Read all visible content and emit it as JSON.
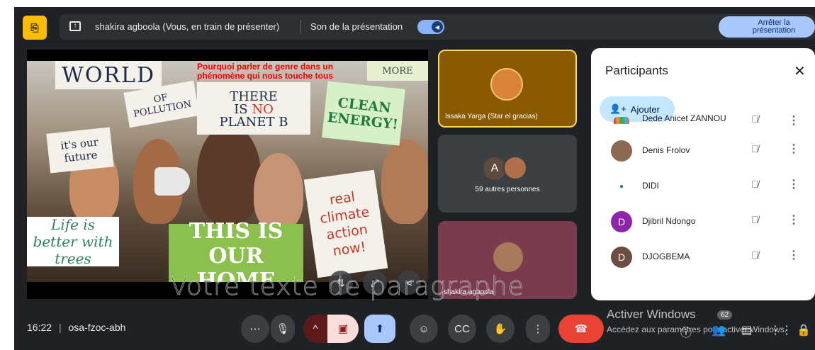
{
  "topbar": {
    "exit_icon": "door-exit-icon",
    "presenter_text": "shakira agboola (Vous, en train de présenter)",
    "sound_label": "Son de la présentation",
    "stop_line1": "Arrêter la",
    "stop_line2": "présentation"
  },
  "slide": {
    "title_line1": "Pourquoi parler de genre dans un",
    "title_line2": "phénomène qui nous touche tous",
    "signs": {
      "world": "WORLD",
      "pollution": "OF POLLUTION",
      "there": "THERE",
      "is": "IS",
      "no": "NO",
      "planet": "PLANET B",
      "more": "MORE",
      "energy": "CLEAN ENERGY!",
      "future": "it's our future",
      "real": "real climate action now!",
      "life": "Life is better with trees",
      "home": "THIS IS OUR HOME"
    }
  },
  "tiles": {
    "t1_name": "Issaka Yarga (Star el gracias)",
    "t2_avatar_letter": "A",
    "t2_label": "59 autres personnes",
    "t3_name": "shakira agboola"
  },
  "watermark": "Votre texte de paragraphe",
  "panel": {
    "title": "Participants",
    "add_label": "Ajouter",
    "participants": [
      {
        "name": "Dede Anicet ZANNOU",
        "initial": ""
      },
      {
        "name": "Denis Frolov",
        "initial": ""
      },
      {
        "name": "DIDI",
        "initial": ""
      },
      {
        "name": "Djibril Ndongo",
        "initial": "D"
      },
      {
        "name": "DJOGBEMA",
        "initial": "D"
      }
    ]
  },
  "bottombar": {
    "time": "16:22",
    "meeting_code": "osa-fzoc-abh",
    "participant_count": "62",
    "activate_windows": "Activer Windows",
    "activate_sub": "Accédez aux paramètres pour activer Windows."
  },
  "colors": {
    "background": "#202124",
    "accent_yellow": "#fbbc04",
    "stop_button": "#a8c7fa",
    "hangup": "#ea4335",
    "camera_off": "#f9dedc",
    "present_active": "#a8c7fa"
  }
}
